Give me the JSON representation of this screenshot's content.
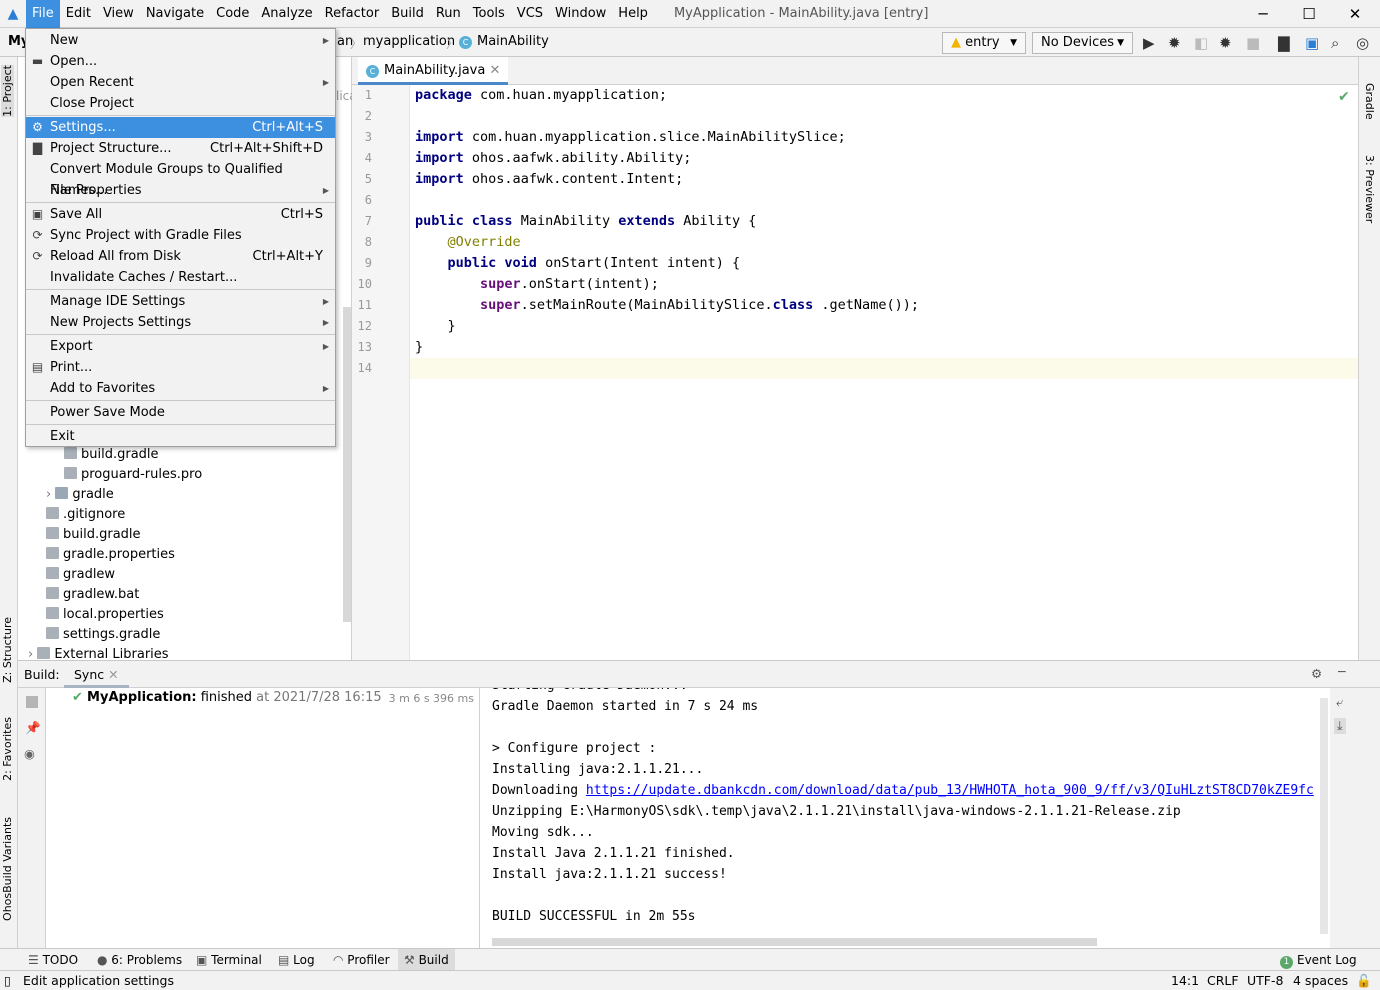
{
  "menubar": {
    "items": [
      "File",
      "Edit",
      "View",
      "Navigate",
      "Code",
      "Analyze",
      "Refactor",
      "Build",
      "Run",
      "Tools",
      "VCS",
      "Window",
      "Help"
    ],
    "window_title": "MyApplication - MainAbility.java [entry]"
  },
  "toolbar": {
    "project_crumb": "My",
    "breadcrumbs": [
      "an",
      "myapplication",
      "MainAbility"
    ],
    "config": "entry",
    "device": "No Devices"
  },
  "file_menu": [
    {
      "label": "New",
      "arrow": true
    },
    {
      "label": "Open...",
      "icon": "folder-icon"
    },
    {
      "label": "Open Recent",
      "arrow": true
    },
    {
      "label": "Close Project"
    },
    {
      "sep": true
    },
    {
      "label": "Settings...",
      "shortcut": "Ctrl+Alt+S",
      "icon": "gear-icon",
      "selected": true
    },
    {
      "label": "Project Structure...",
      "shortcut": "Ctrl+Alt+Shift+D",
      "icon": "project-structure-icon"
    },
    {
      "label": "Convert Module Groups to Qualified Names..."
    },
    {
      "label": "File Properties",
      "arrow": true
    },
    {
      "sep": true
    },
    {
      "label": "Save All",
      "shortcut": "Ctrl+S",
      "icon": "save-icon"
    },
    {
      "label": "Sync Project with Gradle Files",
      "icon": "sync-icon"
    },
    {
      "label": "Reload All from Disk",
      "shortcut": "Ctrl+Alt+Y",
      "icon": "reload-icon"
    },
    {
      "label": "Invalidate Caches / Restart..."
    },
    {
      "sep": true
    },
    {
      "label": "Manage IDE Settings",
      "arrow": true
    },
    {
      "label": "New Projects Settings",
      "arrow": true
    },
    {
      "sep": true
    },
    {
      "label": "Export",
      "arrow": true
    },
    {
      "label": "Print...",
      "icon": "print-icon"
    },
    {
      "label": "Add to Favorites",
      "arrow": true
    },
    {
      "sep": true
    },
    {
      "label": "Power Save Mode"
    },
    {
      "sep": true
    },
    {
      "label": "Exit"
    }
  ],
  "left_strip": [
    "1: Project",
    "Z: Structure",
    "2: Favorites",
    "OhosBuild Variants"
  ],
  "right_strip": [
    "Gradle",
    "3: Previewer"
  ],
  "project_tree": [
    {
      "label": "build.gradle",
      "indent": 2
    },
    {
      "label": "proguard-rules.pro",
      "indent": 2
    },
    {
      "label": "gradle",
      "indent": 1,
      "folder": true,
      "expand": true
    },
    {
      "label": ".gitignore",
      "indent": 1
    },
    {
      "label": "build.gradle",
      "indent": 1
    },
    {
      "label": "gradle.properties",
      "indent": 1
    },
    {
      "label": "gradlew",
      "indent": 1
    },
    {
      "label": "gradlew.bat",
      "indent": 1
    },
    {
      "label": "local.properties",
      "indent": 1
    },
    {
      "label": "settings.gradle",
      "indent": 1
    },
    {
      "label": "External Libraries",
      "indent": 0,
      "expand": true
    }
  ],
  "project_partial": "lica",
  "editor": {
    "tab": "MainAbility.java",
    "lines": [
      [
        [
          "kw",
          "package"
        ],
        [
          "",
          "com.huan.myapplication;"
        ]
      ],
      [],
      [
        [
          "kw",
          "import"
        ],
        [
          "",
          "com.huan.myapplication.slice.MainAbilitySlice;"
        ]
      ],
      [
        [
          "kw",
          "import"
        ],
        [
          "",
          "ohos.aafwk.ability.Ability;"
        ]
      ],
      [
        [
          "kw",
          "import"
        ],
        [
          "",
          "ohos.aafwk.content.Intent;"
        ]
      ],
      [],
      [
        [
          "kw",
          "public class"
        ],
        [
          "",
          "MainAbility "
        ],
        [
          "kw",
          "extends"
        ],
        [
          "",
          "Ability {"
        ]
      ],
      [
        [
          "an",
          "    @Override"
        ]
      ],
      [
        [
          "kw",
          "    public void"
        ],
        [
          "",
          "onStart(Intent intent) {"
        ]
      ],
      [
        [
          "pu",
          "        super"
        ],
        [
          "",
          ".onStart(intent);"
        ]
      ],
      [
        [
          "pu",
          "        super"
        ],
        [
          "",
          ".setMainRoute(MainAbilitySlice."
        ],
        [
          "kw",
          "class"
        ],
        [
          "",
          ".getName());"
        ]
      ],
      [
        [
          "",
          "    }"
        ]
      ],
      [
        [
          "",
          "}"
        ]
      ],
      []
    ]
  },
  "build": {
    "label": "Build:",
    "tab": "Sync",
    "status_project": "MyApplication:",
    "status_text": "finished",
    "status_time": "at 2021/7/28 16:15",
    "duration": "3 m 6 s 396 ms",
    "console": [
      "Starting Gradle Daemon...",
      "Gradle Daemon started in 7 s 24 ms",
      "",
      "> Configure project :",
      "Installing java:2.1.1.21...",
      "Downloading ",
      "Unzipping E:\\HarmonyOS\\sdk\\.temp\\java\\2.1.1.21\\install\\java-windows-2.1.1.21-Release.zip",
      "Moving sdk...",
      "Install Java 2.1.1.21 finished.",
      "Install java:2.1.1.21 success!",
      "",
      "BUILD SUCCESSFUL in 2m 55s"
    ],
    "download_url": "https://update.dbankcdn.com/download/data/pub_13/HWHOTA_hota_900_9/ff/v3/QIuHLztST8CD70kZE9fc"
  },
  "bottom_tabs": [
    "TODO",
    "6: Problems",
    "Terminal",
    "Log",
    "Profiler",
    "Build"
  ],
  "event_log": {
    "label": "Event Log",
    "count": "1"
  },
  "status": {
    "message": "Edit application settings",
    "position": "14:1",
    "line_sep": "CRLF",
    "encoding": "UTF-8",
    "indent": "4 spaces"
  },
  "colors": {
    "accent": "#3d8fe0",
    "keyword": "#000080",
    "annotation": "#808000",
    "link": "#0000ff",
    "success": "#59a869"
  }
}
